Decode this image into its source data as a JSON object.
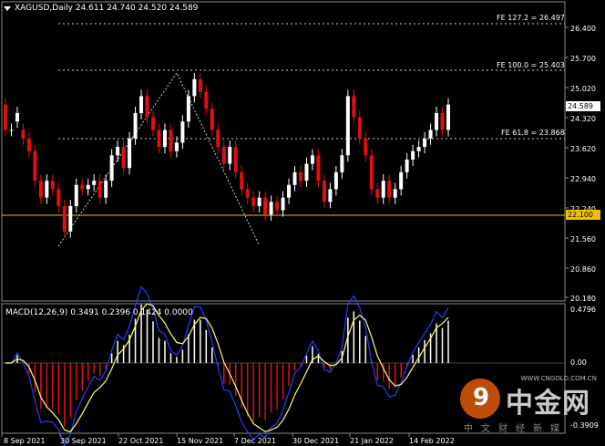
{
  "header": {
    "symbol_line": "XAGUSD,Daily  24.611 24.740 24.520 24.589",
    "macd_line": "MACD(12,26,9) 0.3491 0.2396 0.1424 0.0000"
  },
  "price_axis": [
    "26.400",
    "25.700",
    "25.020",
    "24.320",
    "23.620",
    "22.940",
    "22.240",
    "21.560",
    "20.860",
    "20.180"
  ],
  "macd_axis": [
    "0.4796",
    "0.00",
    "-0.3909"
  ],
  "time_axis": [
    "8 Sep 2021",
    "30 Sep 2021",
    "22 Oct 2021",
    "15 Nov 2021",
    "7 Dec 2021",
    "30 Dec 2021",
    "21 Jan 2022",
    "14 Feb 2022"
  ],
  "fib_levels": [
    {
      "label": "FE 127.2 = 26.497",
      "price": 26.497
    },
    {
      "label": "FE 100.0 = 25.403",
      "price": 25.403
    },
    {
      "label": "FE 61.8 = 23.868",
      "price": 23.868
    }
  ],
  "current_price": "24.589",
  "support_price": "22.100",
  "watermark": {
    "url": "WWW.CNGOLD.COM.CN",
    "brand": "中金网",
    "slogan": "中文财经新媒"
  },
  "colors": {
    "bull": "#ffffff",
    "bear": "#e01010",
    "signal": "#ffff66",
    "macd_line": "#2a3cff",
    "support": "#f0c000",
    "grid": "#8a8a8a"
  },
  "chart_data": {
    "type": "candlestick",
    "title": "XAGUSD,Daily",
    "ylim": [
      20.0,
      26.9
    ],
    "candles": [
      [
        24.6,
        24.0
      ],
      [
        24.0,
        24.0
      ],
      [
        24.2,
        24.4
      ],
      [
        24.0,
        23.8
      ],
      [
        23.8,
        23.5
      ],
      [
        23.5,
        22.8
      ],
      [
        22.8,
        22.4
      ],
      [
        22.4,
        22.8
      ],
      [
        22.8,
        22.6
      ],
      [
        22.6,
        22.2
      ],
      [
        22.2,
        21.6
      ],
      [
        21.6,
        22.2
      ],
      [
        22.2,
        22.7
      ],
      [
        22.7,
        22.6
      ],
      [
        22.6,
        22.7
      ],
      [
        22.7,
        22.8
      ],
      [
        22.8,
        22.4
      ],
      [
        22.4,
        22.8
      ],
      [
        22.8,
        23.4
      ],
      [
        23.4,
        23.6
      ],
      [
        23.6,
        23.1
      ],
      [
        23.1,
        23.8
      ],
      [
        23.8,
        24.4
      ],
      [
        24.4,
        24.8
      ],
      [
        24.8,
        24.3
      ],
      [
        24.3,
        24.0
      ],
      [
        24.0,
        23.6
      ],
      [
        23.6,
        24.0
      ],
      [
        24.0,
        23.5
      ],
      [
        23.5,
        23.7
      ],
      [
        23.7,
        24.2
      ],
      [
        24.2,
        24.8
      ],
      [
        24.8,
        25.2
      ],
      [
        25.2,
        24.9
      ],
      [
        24.9,
        24.5
      ],
      [
        24.5,
        24.0
      ],
      [
        24.0,
        23.6
      ],
      [
        23.6,
        23.2
      ],
      [
        23.2,
        23.6
      ],
      [
        23.6,
        23.0
      ],
      [
        23.0,
        22.6
      ],
      [
        22.6,
        22.4
      ],
      [
        22.4,
        22.2
      ],
      [
        22.2,
        22.4
      ],
      [
        22.4,
        22.0
      ],
      [
        22.0,
        22.3
      ],
      [
        22.3,
        22.1
      ],
      [
        22.1,
        22.4
      ],
      [
        22.4,
        22.7
      ],
      [
        22.7,
        23.0
      ],
      [
        23.0,
        22.8
      ],
      [
        22.8,
        23.2
      ],
      [
        23.2,
        23.4
      ],
      [
        23.4,
        22.8
      ],
      [
        22.8,
        22.3
      ],
      [
        22.3,
        22.6
      ],
      [
        22.6,
        23.0
      ],
      [
        23.0,
        23.4
      ],
      [
        23.4,
        24.8
      ],
      [
        24.8,
        24.3
      ],
      [
        24.3,
        23.8
      ],
      [
        23.8,
        23.4
      ],
      [
        23.4,
        22.6
      ],
      [
        22.6,
        22.4
      ],
      [
        22.4,
        22.8
      ],
      [
        22.8,
        22.4
      ],
      [
        22.4,
        22.6
      ],
      [
        22.6,
        23.0
      ],
      [
        23.0,
        23.3
      ],
      [
        23.3,
        23.5
      ],
      [
        23.5,
        23.6
      ],
      [
        23.6,
        23.8
      ],
      [
        23.8,
        24.0
      ],
      [
        24.0,
        24.4
      ],
      [
        24.4,
        24.0
      ],
      [
        24.0,
        24.6
      ]
    ]
  }
}
